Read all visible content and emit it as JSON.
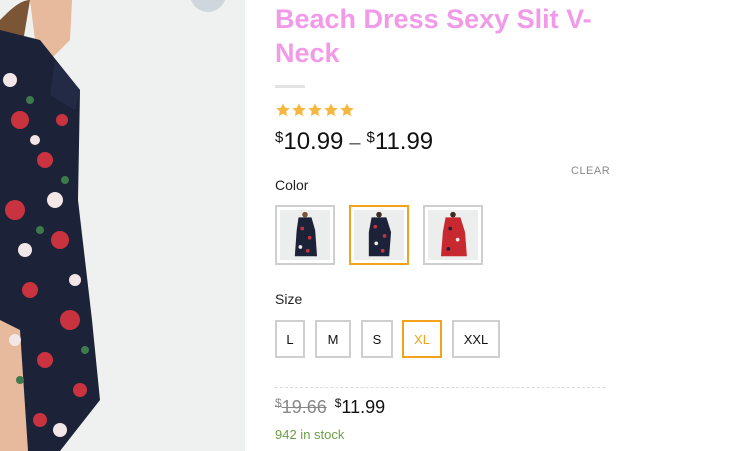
{
  "product": {
    "title": "Beach Dress Sexy Slit V-Neck",
    "rating_stars": 5,
    "price_min": "10.99",
    "price_max": "11.99",
    "currency": "$",
    "range_separator": "–"
  },
  "color": {
    "label": "Color",
    "clear_label": "CLEAR",
    "options": [
      {
        "name": "navy-floral-1",
        "selected": false
      },
      {
        "name": "navy-floral-2",
        "selected": true
      },
      {
        "name": "red-floral",
        "selected": false
      }
    ]
  },
  "size": {
    "label": "Size",
    "options": [
      "L",
      "M",
      "S",
      "XL",
      "XXL"
    ],
    "selected": "XL"
  },
  "variation": {
    "old_price": "19.66",
    "new_price": "11.99",
    "stock_text": "942 in stock"
  },
  "colors": {
    "title": "#f09ae8",
    "accent": "#f2a21b",
    "star": "#f5b73f",
    "stock": "#6b9e4a"
  }
}
